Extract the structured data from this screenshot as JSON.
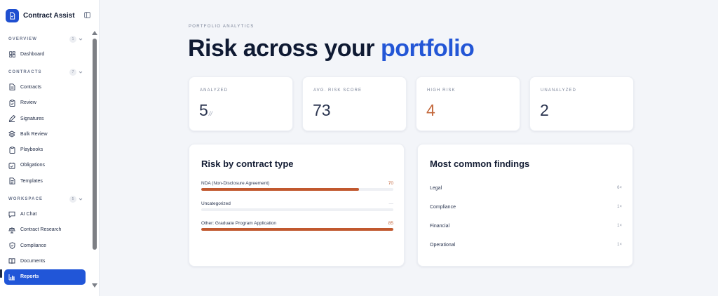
{
  "app": {
    "name": "Contract Assist"
  },
  "sidebar": {
    "sections": [
      {
        "title": "OVERVIEW",
        "count": "1",
        "items": [
          {
            "label": "Dashboard",
            "icon": "dashboard-icon"
          }
        ]
      },
      {
        "title": "CONTRACTS",
        "count": "7",
        "items": [
          {
            "label": "Contracts",
            "icon": "file-icon"
          },
          {
            "label": "Review",
            "icon": "clipboard-check-icon"
          },
          {
            "label": "Signatures",
            "icon": "pen-icon"
          },
          {
            "label": "Bulk Review",
            "icon": "layers-icon"
          },
          {
            "label": "Playbooks",
            "icon": "clipboard-icon"
          },
          {
            "label": "Obligations",
            "icon": "calendar-check-icon"
          },
          {
            "label": "Templates",
            "icon": "document-icon"
          }
        ]
      },
      {
        "title": "WORKSPACE",
        "count": "5",
        "items": [
          {
            "label": "AI Chat",
            "icon": "chat-icon"
          },
          {
            "label": "Contract Research",
            "icon": "scale-icon"
          },
          {
            "label": "Compliance",
            "icon": "shield-icon"
          },
          {
            "label": "Documents",
            "icon": "book-icon"
          },
          {
            "label": "Reports",
            "icon": "bar-chart-icon",
            "active": true
          }
        ]
      }
    ]
  },
  "page": {
    "eyebrow": "PORTFOLIO ANALYTICS",
    "title_main": "Risk across your ",
    "title_accent": "portfolio"
  },
  "stats": [
    {
      "label": "ANALYZED",
      "value": "5",
      "suffix": "//"
    },
    {
      "label": "AVG. RISK SCORE",
      "value": "73"
    },
    {
      "label": "HIGH RISK",
      "value": "4",
      "status": "warning"
    },
    {
      "label": "UNANALYZED",
      "value": "2"
    }
  ],
  "risk_by_type": {
    "title": "Risk by contract type",
    "rows": [
      {
        "name": "NDA (Non-Disclosure Agreement)",
        "score": "70",
        "fill": 0.82
      },
      {
        "name": "Uncategorized",
        "score": "—",
        "fill": 0
      },
      {
        "name": "Other: Graduate Program Application",
        "score": "85",
        "fill": 1.0
      }
    ]
  },
  "findings": {
    "title": "Most common findings",
    "rows": [
      {
        "name": "Legal",
        "count": "6×"
      },
      {
        "name": "Compliance",
        "count": "1×"
      },
      {
        "name": "Financial",
        "count": "1×"
      },
      {
        "name": "Operational",
        "count": "1×"
      }
    ]
  },
  "colors": {
    "accent": "#2356d6",
    "warning": "#c46a3e",
    "bar": "#c1582e",
    "active_nav": "#2156d8"
  }
}
